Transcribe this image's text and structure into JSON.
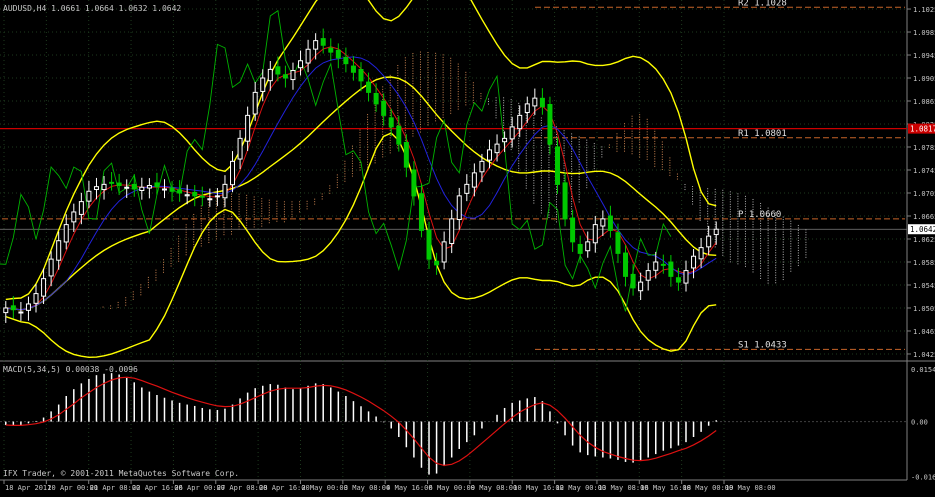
{
  "header": {
    "symbol_line": "AUDUSD,H4 1.0661 1.0664 1.0632 1.0642",
    "macd_line": "MACD(5,34,5) 0.00038 -0.0096",
    "copyright": "IFX Trader, © 2001-2011 MetaQuotes Software Corp."
  },
  "current_price_label": "1.0642",
  "resistance_price_label": "1.0817",
  "pivots": [
    {
      "label": "R2 1.1028",
      "value": 1.1028,
      "color": "#c86428"
    },
    {
      "label": "R1 1.0801",
      "value": 1.0801,
      "color": "#c86428"
    },
    {
      "label": "P 1.0660",
      "value": 1.066,
      "color": "#c86428"
    },
    {
      "label": "S1 1.0433",
      "value": 1.0433,
      "color": "#c86428"
    }
  ],
  "colors": {
    "background": "#000000",
    "grid": "#1e3a1e",
    "bull_candle": "#ffffff",
    "bear_candle": "#00c800",
    "bollinger": "#ffff00",
    "fast_ma": "#dd1111",
    "slow_ma": "#2222dd",
    "chikou": "#00b400",
    "cloud_bull": "#c88250",
    "cloud_bear": "#b4b4b4",
    "resistance_line": "#cc0000",
    "macd_hist": "#ffffff",
    "macd_signal": "#dd1111"
  },
  "chart_data": [
    {
      "type": "line",
      "title": "AUDUSD,H4",
      "y_axis_ticks": [
        "1.1025",
        "1.0985",
        "1.0945",
        "1.0905",
        "1.0865",
        "1.0825",
        "1.0785",
        "1.0745",
        "1.0705",
        "1.0665",
        "1.0625",
        "1.0585",
        "1.0545",
        "1.0505",
        "1.0465",
        "1.0425"
      ],
      "ylim": [
        1.0418,
        1.1032
      ],
      "x_tick_labels": [
        "18 Apr 2011",
        "20 Apr 00:00",
        "21 Apr 08:00",
        "22 Apr 16:00",
        "26 Apr 00:00",
        "27 Apr 08:00",
        "28 Apr 16:00",
        "2 May 00:00",
        "3 May 08:00",
        "4 May 16:00",
        "6 May 00:00",
        "9 May 08:00",
        "10 May 16:00",
        "12 May 00:00",
        "13 May 08:00",
        "16 May 16:00",
        "18 May 00:00",
        "19 May 08:00"
      ],
      "close_series": [
        1.0505,
        1.0502,
        1.0498,
        1.0512,
        1.053,
        1.0556,
        1.059,
        1.0622,
        1.065,
        1.0672,
        1.069,
        1.0708,
        1.0716,
        1.072,
        1.0722,
        1.0718,
        1.0715,
        1.0712,
        1.0715,
        1.0718,
        1.0716,
        1.0712,
        1.0708,
        1.0705,
        1.0702,
        1.07,
        1.0698,
        1.0695,
        1.07,
        1.072,
        1.076,
        1.08,
        1.084,
        1.088,
        1.0905,
        1.092,
        1.0912,
        1.0905,
        1.0918,
        1.0935,
        1.0955,
        1.097,
        1.0962,
        1.095,
        1.094,
        1.093,
        1.0915,
        1.09,
        1.088,
        1.086,
        1.084,
        1.082,
        1.079,
        1.075,
        1.07,
        1.064,
        1.059,
        1.058,
        1.062,
        1.066,
        1.07,
        1.072,
        1.074,
        1.076,
        1.078,
        1.079,
        1.08,
        1.082,
        1.084,
        1.086,
        1.087,
        1.0855,
        1.079,
        1.072,
        1.066,
        1.062,
        1.06,
        1.062,
        1.065,
        1.066,
        1.064,
        1.06,
        1.056,
        1.054,
        1.055,
        1.057,
        1.0585,
        1.058,
        1.056,
        1.055,
        1.057,
        1.0595,
        1.061,
        1.063,
        1.0642
      ],
      "pivot_values": {
        "R2": 1.1028,
        "R1": 1.0801,
        "P": 1.066,
        "S1": 1.0433
      },
      "current_price": 1.0642,
      "resistance_line": 1.0817
    },
    {
      "type": "bar",
      "title": "MACD(5,34,5)",
      "y_axis_ticks": [
        "0.01541",
        "0.00",
        "-0.01607"
      ],
      "ylim": [
        -0.0165,
        0.0157
      ],
      "histogram": [
        -0.001,
        -0.0012,
        -0.001,
        -0.0005,
        0.0002,
        0.0012,
        0.003,
        0.005,
        0.0075,
        0.0095,
        0.0112,
        0.0125,
        0.0136,
        0.014,
        0.0142,
        0.0138,
        0.0128,
        0.0115,
        0.01,
        0.0088,
        0.0078,
        0.007,
        0.0062,
        0.0055,
        0.005,
        0.0046,
        0.004,
        0.0036,
        0.0034,
        0.0038,
        0.005,
        0.0068,
        0.0085,
        0.0098,
        0.0105,
        0.011,
        0.0108,
        0.01,
        0.0095,
        0.0098,
        0.0105,
        0.0112,
        0.011,
        0.01,
        0.0088,
        0.0075,
        0.006,
        0.0045,
        0.003,
        0.0015,
        -0.0002,
        -0.002,
        -0.0045,
        -0.0075,
        -0.0105,
        -0.0135,
        -0.0155,
        -0.0152,
        -0.013,
        -0.0105,
        -0.008,
        -0.006,
        -0.004,
        -0.002,
        0.0,
        0.002,
        0.004,
        0.0055,
        0.0062,
        0.0068,
        0.0072,
        0.006,
        0.003,
        -0.0005,
        -0.004,
        -0.007,
        -0.009,
        -0.0098,
        -0.0102,
        -0.0105,
        -0.0108,
        -0.0112,
        -0.0118,
        -0.012,
        -0.0115,
        -0.0105,
        -0.0095,
        -0.0085,
        -0.0078,
        -0.007,
        -0.006,
        -0.0045,
        -0.003,
        -0.0012,
        0.0004
      ],
      "signal": [
        -0.001,
        -0.0011,
        -0.0011,
        -0.0009,
        -0.0006,
        -0.0001,
        0.0008,
        0.002,
        0.0036,
        0.0052,
        0.007,
        0.0085,
        0.01,
        0.0112,
        0.0122,
        0.0128,
        0.013,
        0.0127,
        0.012,
        0.0112,
        0.0104,
        0.0095,
        0.0086,
        0.0078,
        0.007,
        0.0063,
        0.0057,
        0.0051,
        0.0046,
        0.0044,
        0.0045,
        0.0051,
        0.006,
        0.007,
        0.008,
        0.0089,
        0.0095,
        0.0098,
        0.0098,
        0.0098,
        0.01,
        0.0104,
        0.0106,
        0.0105,
        0.01,
        0.0093,
        0.0083,
        0.0072,
        0.006,
        0.0046,
        0.0032,
        0.0016,
        -0.0002,
        -0.0025,
        -0.005,
        -0.0078,
        -0.0104,
        -0.0122,
        -0.0128,
        -0.0125,
        -0.0115,
        -0.01,
        -0.0082,
        -0.0063,
        -0.0044,
        -0.0025,
        -0.0006,
        0.0012,
        0.0028,
        0.004,
        0.005,
        0.0055,
        0.0048,
        0.0032,
        0.001,
        -0.0015,
        -0.004,
        -0.006,
        -0.0075,
        -0.0087,
        -0.0095,
        -0.0102,
        -0.0108,
        -0.0113,
        -0.0114,
        -0.0112,
        -0.0107,
        -0.01,
        -0.0093,
        -0.0085,
        -0.0078,
        -0.0068,
        -0.0056,
        -0.0042,
        -0.0026
      ]
    }
  ]
}
